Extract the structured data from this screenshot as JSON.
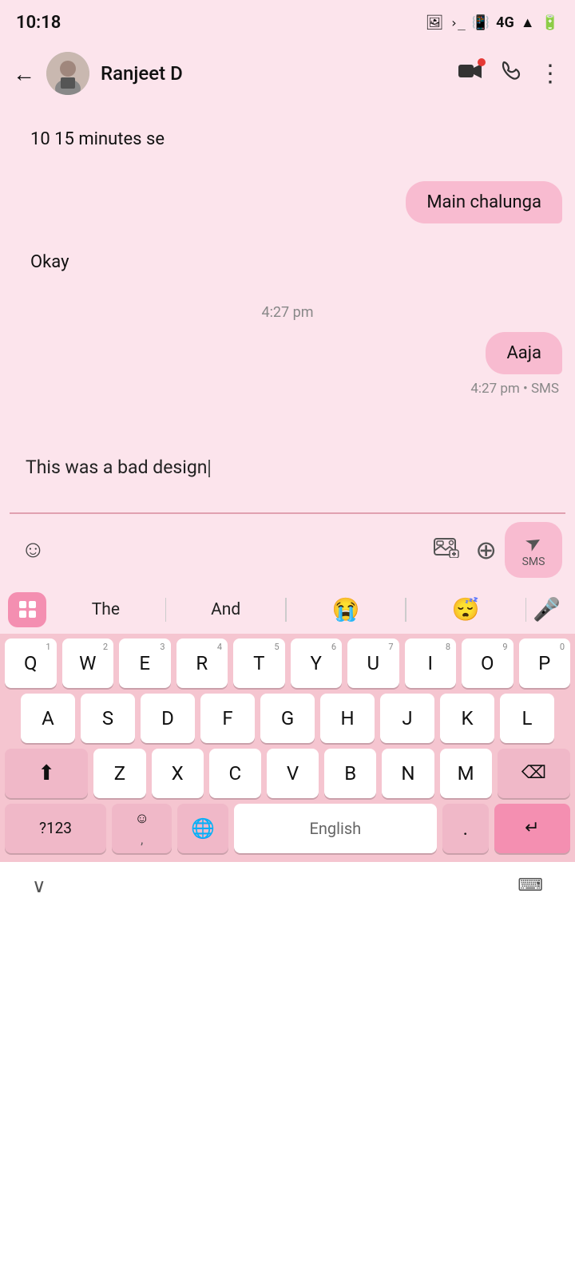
{
  "statusBar": {
    "time": "10:18",
    "icons": [
      "📷",
      ">_",
      "🔔",
      "4G",
      "▲",
      "🔋"
    ]
  },
  "header": {
    "contactName": "Ranjeet D",
    "backLabel": "←",
    "videoCallLabel": "video",
    "phoneCallLabel": "phone",
    "moreLabel": "⋮"
  },
  "messages": [
    {
      "id": "msg1",
      "type": "left",
      "text": "10 15 minutes se"
    },
    {
      "id": "msg2",
      "type": "right",
      "text": "Main chalunga"
    },
    {
      "id": "msg3",
      "type": "left",
      "text": "Okay"
    },
    {
      "id": "msg4",
      "type": "timestamp",
      "text": "4:27 pm"
    },
    {
      "id": "msg5",
      "type": "right",
      "text": "Aaja"
    },
    {
      "id": "msg6",
      "type": "sms-time",
      "text": "4:27 pm • SMS"
    }
  ],
  "inputArea": {
    "messageText": "This was a bad design",
    "emojiIconLabel": "☺",
    "attachIconLabel": "attach",
    "addIconLabel": "+",
    "sendLabel": "SMS"
  },
  "keyboard": {
    "suggestions": [
      "The",
      "And"
    ],
    "rows": [
      [
        "Q",
        "W",
        "E",
        "R",
        "T",
        "Y",
        "U",
        "I",
        "O",
        "P"
      ],
      [
        "A",
        "S",
        "D",
        "F",
        "G",
        "H",
        "J",
        "K",
        "L"
      ],
      [
        "Z",
        "X",
        "C",
        "V",
        "B",
        "N",
        "M"
      ]
    ],
    "numbers": [
      "1",
      "2",
      "3",
      "4",
      "5",
      "6",
      "7",
      "8",
      "9",
      "0"
    ],
    "spaceLabel": "English",
    "symbolsLabel": "?123",
    "enterLabel": "↵"
  },
  "bottomNav": {
    "chevronLabel": "∨",
    "keyboardLabel": "⌨"
  },
  "colors": {
    "background": "#fce4ec",
    "bubbleRight": "#f8bbd0",
    "bubbleLeft": "#fce4ec",
    "keyboardBg": "#f5c5d0",
    "keyBg": "#ffffff",
    "specialKeyBg": "#f0b8c8",
    "enterKeyBg": "#f48fb1",
    "suggestionsBg": "#fce4ec"
  }
}
